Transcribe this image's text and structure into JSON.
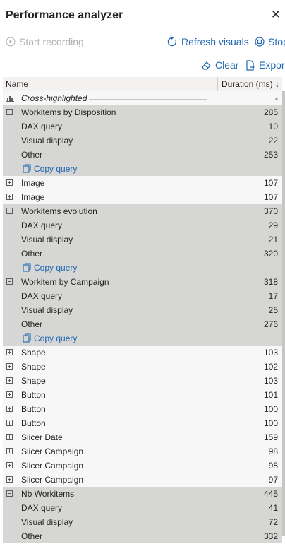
{
  "panel": {
    "title": "Performance analyzer"
  },
  "toolbar": {
    "start_recording": "Start recording",
    "refresh_visuals": "Refresh visuals",
    "stop": "Stop",
    "clear": "Clear",
    "export": "Export"
  },
  "table": {
    "columns": {
      "name": "Name",
      "duration": "Duration (ms)"
    },
    "rows": [
      {
        "kind": "cross",
        "label": "Cross-highlighted",
        "value": "-"
      },
      {
        "kind": "group",
        "label": "Workitems by Disposition",
        "value": "285"
      },
      {
        "kind": "child",
        "label": "DAX query",
        "value": "10"
      },
      {
        "kind": "child",
        "label": "Visual display",
        "value": "22"
      },
      {
        "kind": "child",
        "label": "Other",
        "value": "253"
      },
      {
        "kind": "copy",
        "label": "Copy query",
        "value": ""
      },
      {
        "kind": "item",
        "label": "Image",
        "value": "107"
      },
      {
        "kind": "item",
        "label": "Image",
        "value": "107"
      },
      {
        "kind": "group",
        "label": "Workitems evolution",
        "value": "370"
      },
      {
        "kind": "child",
        "label": "DAX query",
        "value": "29"
      },
      {
        "kind": "child",
        "label": "Visual display",
        "value": "21"
      },
      {
        "kind": "child",
        "label": "Other",
        "value": "320"
      },
      {
        "kind": "copy",
        "label": "Copy query",
        "value": ""
      },
      {
        "kind": "group",
        "label": "Workitem by Campaign",
        "value": "318"
      },
      {
        "kind": "child",
        "label": "DAX query",
        "value": "17"
      },
      {
        "kind": "child",
        "label": "Visual display",
        "value": "25"
      },
      {
        "kind": "child",
        "label": "Other",
        "value": "276"
      },
      {
        "kind": "copy",
        "label": "Copy query",
        "value": ""
      },
      {
        "kind": "item",
        "label": "Shape",
        "value": "103"
      },
      {
        "kind": "item",
        "label": "Shape",
        "value": "102"
      },
      {
        "kind": "item",
        "label": "Shape",
        "value": "103"
      },
      {
        "kind": "item",
        "label": "Button",
        "value": "101"
      },
      {
        "kind": "item",
        "label": "Button",
        "value": "100"
      },
      {
        "kind": "item",
        "label": "Button",
        "value": "100"
      },
      {
        "kind": "item",
        "label": "Slicer Date",
        "value": "159"
      },
      {
        "kind": "item",
        "label": "Slicer Campaign",
        "value": "98"
      },
      {
        "kind": "item",
        "label": "Slicer Campaign",
        "value": "98"
      },
      {
        "kind": "item",
        "label": "Slicer Campaign",
        "value": "97"
      },
      {
        "kind": "group",
        "label": "Nb Workitems",
        "value": "445"
      },
      {
        "kind": "child",
        "label": "DAX query",
        "value": "41"
      },
      {
        "kind": "child",
        "label": "Visual display",
        "value": "72"
      },
      {
        "kind": "child",
        "label": "Other",
        "value": "332"
      }
    ]
  },
  "colors": {
    "link": "#1f67b2",
    "group_bg": "#d6d6d5",
    "disabled": "#b3b0ad"
  },
  "icons": [
    "play-circle-icon",
    "refresh-icon",
    "stop-circle-icon",
    "eraser-icon",
    "export-icon",
    "close-icon",
    "chart-icon",
    "collapse-icon",
    "expand-icon",
    "copy-icon",
    "sort-down-icon"
  ]
}
